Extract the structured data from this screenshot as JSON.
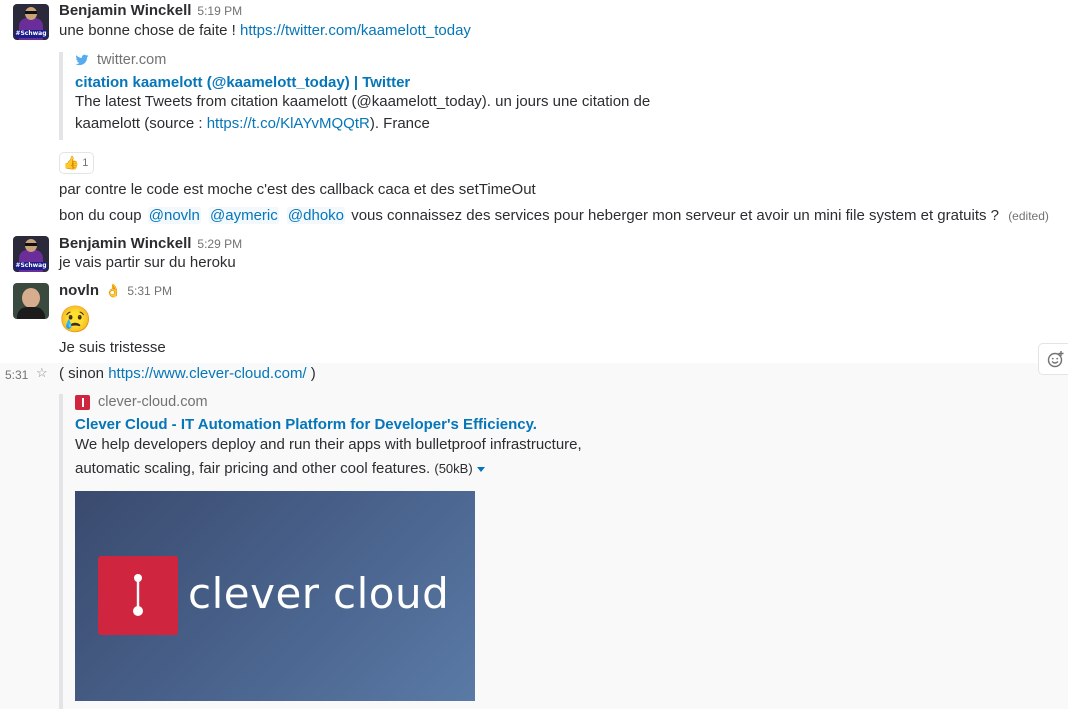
{
  "messages": {
    "m1": {
      "author": "Benjamin Winckell",
      "time": "5:19 PM",
      "avatar_tag": "#Schwag",
      "text_prefix": "une bonne chose de faite !",
      "link": "https://twitter.com/kaamelott_today",
      "attachment": {
        "service": "twitter.com",
        "title": "citation kaamelott (@kaamelott_today) | Twitter",
        "text_line1": "The latest Tweets from citation kaamelott (@kaamelott_today). un jours une citation de",
        "text_line2_prefix": "kaamelott (source : ",
        "text_line2_link": "https://t.co/KlAYvMQQtR",
        "text_line2_suffix": "). France"
      },
      "reaction": {
        "emoji": "👍",
        "count": "1"
      }
    },
    "m2": {
      "text": "par contre le code est moche c'est des callback caca et des setTimeOut"
    },
    "m3": {
      "text_prefix": "bon du coup",
      "mentions": [
        "@novln",
        "@aymeric",
        "@dhoko"
      ],
      "text_suffix": "vous connaissez des services pour heberger mon serveur et avoir un mini file system et gratuits ?",
      "edited": "(edited)"
    },
    "m4": {
      "author": "Benjamin Winckell",
      "time": "5:29 PM",
      "avatar_tag": "#Schwag",
      "text": "je vais partir sur du heroku"
    },
    "m5": {
      "author": "novln",
      "status_emoji": "👌",
      "time": "5:31 PM",
      "emoji": "😢",
      "text": "Je suis tristesse"
    },
    "m6": {
      "gutter_time": "5:31",
      "text_prefix": "( sinon",
      "link": "https://www.clever-cloud.com/",
      "text_suffix": ")",
      "attachment": {
        "service": "clever-cloud.com",
        "title": "Clever Cloud - IT Automation Platform for Developer's Efficiency.",
        "text_line1": "We help developers deploy and run their apps with bulletproof infrastructure,",
        "text_line2": "automatic scaling, fair pricing and other cool features.",
        "size": "(50kB)",
        "image_word1": "clever",
        "image_word2": "cloud"
      }
    }
  },
  "colors": {
    "link": "#0576b9",
    "accent_red": "#d0253e",
    "twitter_blue": "#55acee"
  },
  "icons": {
    "star": "star-icon",
    "add_reaction": "add-reaction-icon",
    "twitter": "twitter-icon",
    "clever_cloud": "clever-cloud-icon"
  }
}
